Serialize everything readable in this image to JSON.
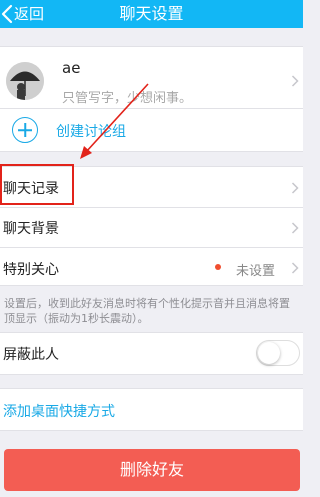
{
  "nav": {
    "back_label": "返回",
    "title": "聊天设置"
  },
  "profile": {
    "name": "ae",
    "signature": "只管写字，少想闲事。"
  },
  "create_group": {
    "label": "创建讨论组"
  },
  "rows": {
    "chat_history": "聊天记录",
    "chat_background": "聊天背景",
    "special_care": {
      "label": "特别关心",
      "value": "未设置"
    }
  },
  "hint": "设置后，收到此好友消息时将有个性化提示音并且消息将置顶显示（振动为1秒长震动）。",
  "block": {
    "label": "屏蔽此人",
    "enabled": false
  },
  "shortcut": {
    "label": "添加桌面快捷方式"
  },
  "delete_button": {
    "label": "删除好友"
  },
  "colors": {
    "nav_bg": "#12b7f5",
    "accent": "#19a9e6",
    "danger": "#f35d53",
    "annotation": "#e2231a",
    "unread_dot": "#f04e2f"
  }
}
